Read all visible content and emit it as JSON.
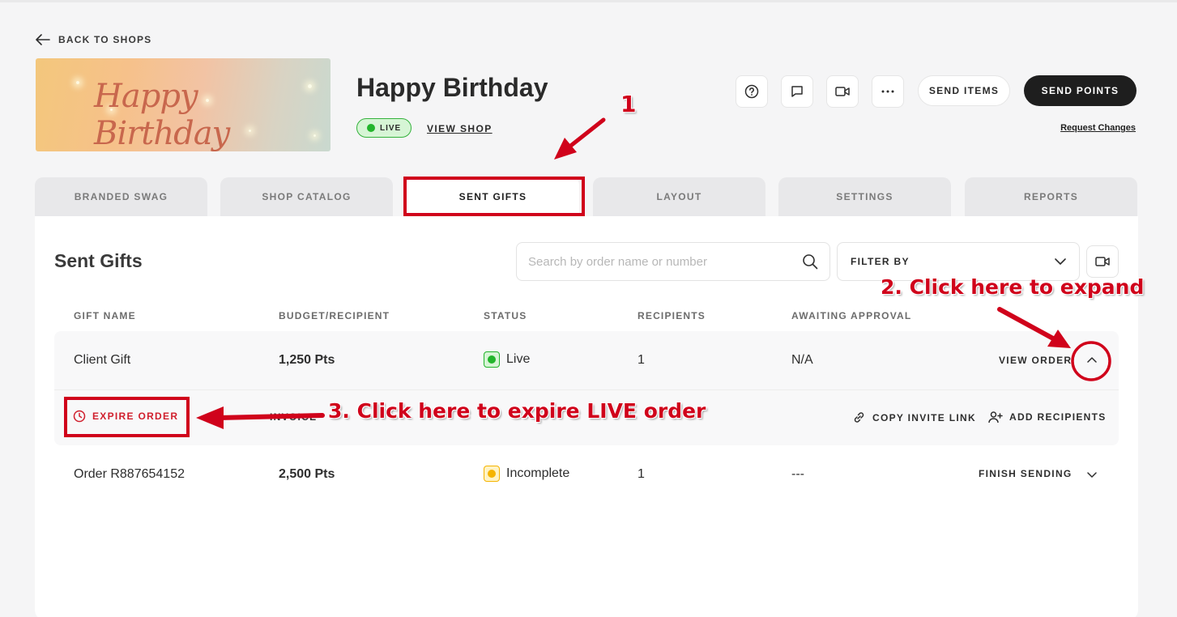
{
  "nav": {
    "back_label": "BACK TO SHOPS"
  },
  "shop": {
    "banner_text": "Happy Birthday",
    "title": "Happy Birthday",
    "status_badge": "LIVE",
    "view_shop_label": "VIEW SHOP"
  },
  "header_actions": {
    "icons": [
      "help-icon",
      "chat-icon",
      "video-icon",
      "more-icon"
    ],
    "send_items_label": "SEND ITEMS",
    "send_points_label": "SEND POINTS",
    "request_changes_label": "Request Changes"
  },
  "tabs": [
    {
      "label": "BRANDED SWAG",
      "active": false
    },
    {
      "label": "SHOP CATALOG",
      "active": false
    },
    {
      "label": "SENT GIFTS",
      "active": true
    },
    {
      "label": "LAYOUT",
      "active": false
    },
    {
      "label": "SETTINGS",
      "active": false
    },
    {
      "label": "REPORTS",
      "active": false
    }
  ],
  "sent_gifts": {
    "title": "Sent Gifts",
    "search_placeholder": "Search by order name or number",
    "filter_label": "FILTER BY",
    "columns": [
      "GIFT NAME",
      "BUDGET/RECIPIENT",
      "STATUS",
      "RECIPIENTS",
      "AWAITING APPROVAL"
    ],
    "rows": [
      {
        "name": "Client Gift",
        "budget": "1,250 Pts",
        "status": "Live",
        "status_color": "#22b52b",
        "recipients": "1",
        "awaiting": "N/A",
        "action": "VIEW ORDER",
        "expanded": true,
        "sub_actions": {
          "expire": "EXPIRE ORDER",
          "invoice": "INVOICE",
          "copy_link": "COPY INVITE LINK",
          "add_recipients": "ADD RECIPIENTS"
        }
      },
      {
        "name": "Order R887654152",
        "budget": "2,500 Pts",
        "status": "Incomplete",
        "status_color": "#f5b400",
        "recipients": "1",
        "awaiting": "---",
        "action": "FINISH SENDING",
        "expanded": false
      }
    ]
  },
  "annotations": {
    "step1": "1",
    "step2": "2. Click here to expand",
    "step3": "3. Click here to expire LIVE order",
    "color": "#d0021b"
  }
}
